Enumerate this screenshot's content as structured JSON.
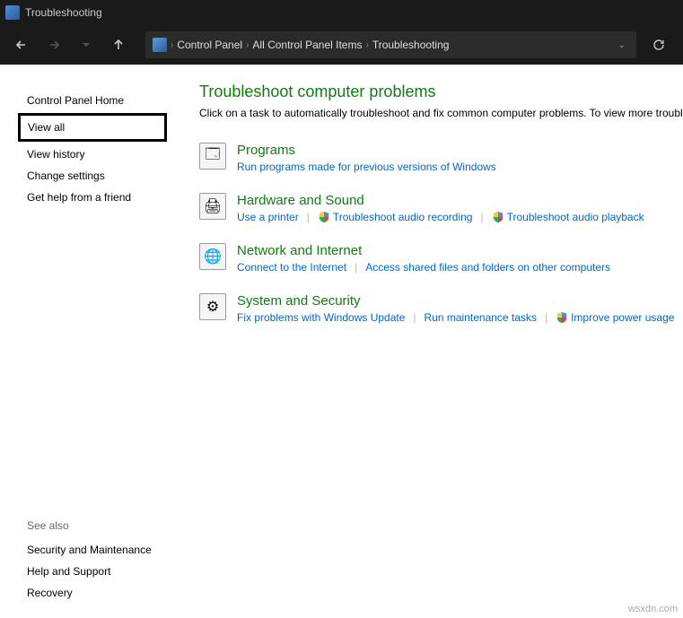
{
  "window": {
    "title": "Troubleshooting"
  },
  "breadcrumb": {
    "items": [
      "Control Panel",
      "All Control Panel Items",
      "Troubleshooting"
    ]
  },
  "sidebar": {
    "items": [
      {
        "label": "Control Panel Home",
        "boxed": false
      },
      {
        "label": "View all",
        "boxed": true
      },
      {
        "label": "View history",
        "boxed": false
      },
      {
        "label": "Change settings",
        "boxed": false
      },
      {
        "label": "Get help from a friend",
        "boxed": false
      }
    ],
    "seeAlsoLabel": "See also",
    "seeAlso": [
      {
        "label": "Security and Maintenance"
      },
      {
        "label": "Help and Support"
      },
      {
        "label": "Recovery"
      }
    ]
  },
  "main": {
    "heading": "Troubleshoot computer problems",
    "subtitle": "Click on a task to automatically troubleshoot and fix common computer problems. To view more troubl",
    "categories": [
      {
        "title": "Programs",
        "iconGlyph": "🗔",
        "tasks": [
          {
            "label": "Run programs made for previous versions of Windows",
            "shield": false
          }
        ]
      },
      {
        "title": "Hardware and Sound",
        "iconGlyph": "🖨",
        "tasks": [
          {
            "label": "Use a printer",
            "shield": false
          },
          {
            "label": "Troubleshoot audio recording",
            "shield": true
          },
          {
            "label": "Troubleshoot audio playback",
            "shield": true
          }
        ]
      },
      {
        "title": "Network and Internet",
        "iconGlyph": "🌐",
        "tasks": [
          {
            "label": "Connect to the Internet",
            "shield": false
          },
          {
            "label": "Access shared files and folders on other computers",
            "shield": false
          }
        ]
      },
      {
        "title": "System and Security",
        "iconGlyph": "⚙",
        "tasks": [
          {
            "label": "Fix problems with Windows Update",
            "shield": false
          },
          {
            "label": "Run maintenance tasks",
            "shield": false
          },
          {
            "label": "Improve power usage",
            "shield": true
          }
        ]
      }
    ]
  },
  "watermark": "wsxdn.com"
}
